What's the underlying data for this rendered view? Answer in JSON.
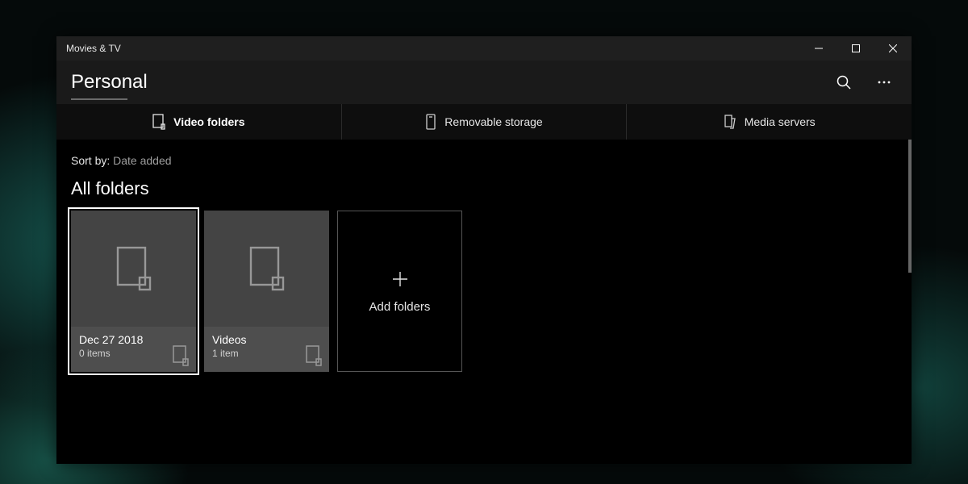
{
  "titlebar": {
    "app_name": "Movies & TV"
  },
  "header": {
    "page_title": "Personal"
  },
  "tabs": [
    {
      "label": "Video folders",
      "icon": "folder-outline-icon"
    },
    {
      "label": "Removable storage",
      "icon": "drive-icon"
    },
    {
      "label": "Media servers",
      "icon": "server-icon"
    }
  ],
  "sort": {
    "prefix": "Sort by:",
    "value": "Date added"
  },
  "section": {
    "heading": "All folders"
  },
  "folders": [
    {
      "name": "Dec 27 2018",
      "count": "0 items"
    },
    {
      "name": "Videos",
      "count": "1 item"
    }
  ],
  "add_tile": {
    "label": "Add folders"
  }
}
